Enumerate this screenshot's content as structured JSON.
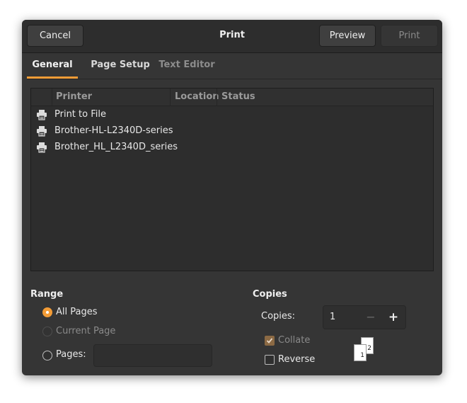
{
  "header": {
    "title": "Print",
    "cancel_label": "Cancel",
    "preview_label": "Preview",
    "print_label": "Print"
  },
  "tabs": [
    {
      "label": "General",
      "active": true
    },
    {
      "label": "Page Setup",
      "active": false
    },
    {
      "label": "Text Editor",
      "active": false,
      "disabled": true
    }
  ],
  "printer_list": {
    "columns": [
      "Printer",
      "Location",
      "Status"
    ],
    "rows": [
      {
        "icon": "printer-icon",
        "name": "Print to File",
        "location": "",
        "status": ""
      },
      {
        "icon": "printer-icon",
        "name": "Brother-HL-L2340D-series",
        "location": "",
        "status": ""
      },
      {
        "icon": "printer-icon",
        "name": "Brother_HL_L2340D_series",
        "location": "",
        "status": ""
      }
    ]
  },
  "range": {
    "title": "Range",
    "all_pages_label": "All Pages",
    "current_page_label": "Current Page",
    "pages_label": "Pages:",
    "pages_value": "",
    "selected": "All Pages"
  },
  "copies": {
    "title": "Copies",
    "copies_label": "Copies:",
    "copies_value": "1",
    "minus_glyph": "−",
    "plus_glyph": "+",
    "collate_label": "Collate",
    "collate_checked": true,
    "collate_disabled": true,
    "reverse_label": "Reverse",
    "reverse_checked": false,
    "collate_preview": [
      "1",
      "2"
    ]
  },
  "colors": {
    "accent": "#f39c36",
    "window_bg": "#353535",
    "headerbar_bg": "#2d2d2d"
  }
}
